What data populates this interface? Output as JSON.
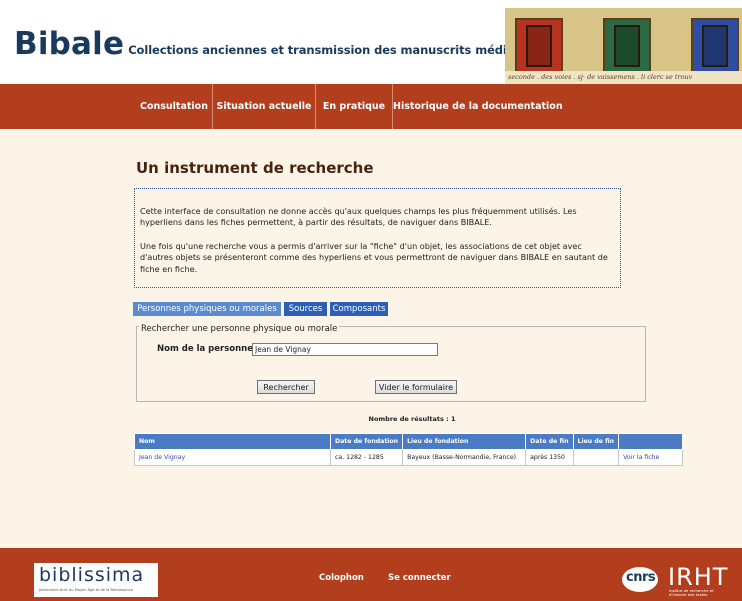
{
  "header": {
    "brand": "Bibale",
    "subtitle": "Collections anciennes et transmission des manuscrits médiévaux",
    "illumination_caption": "seconde . des voies . sj· de vaissemens . li clerc se trouv"
  },
  "nav": {
    "items": [
      {
        "label": "Consultation"
      },
      {
        "label": "Situation actuelle"
      },
      {
        "label": "En pratique"
      },
      {
        "label": "Historique de la documentation"
      }
    ]
  },
  "main": {
    "title": "Un instrument de recherche",
    "intro_p1": "Cette interface de consultation ne donne accès qu'aux quelques champs les plus fréquemment utilisés. Les hyperliens dans les fiches permettent, à partir des résultats, de naviguer dans BIBALE.",
    "intro_p2": "Une fois qu'une recherche vous a permis d'arriver sur la \"fiche\" d'un objet, les associations de cet objet avec d'autres objets se présenteront comme des hyperliens et vous permettront de naviguer dans BIBALE en sautant de fiche en fiche."
  },
  "tabs": [
    {
      "label": "Personnes physiques ou morales",
      "active": true
    },
    {
      "label": "Sources",
      "active": false
    },
    {
      "label": "Composants",
      "active": false
    }
  ],
  "search": {
    "legend": "Rechercher une personne physique ou morale",
    "name_label": "Nom de la personne :",
    "name_value": "Jean de Vignay",
    "search_button": "Rechercher",
    "clear_button": "Vider le formulaire"
  },
  "results": {
    "count_text": "Nombre de résultats : 1",
    "columns": [
      "Nom",
      "Date de fondation",
      "Lieu de fondation",
      "Date de fin",
      "Lieu de fin",
      ""
    ],
    "rows": [
      {
        "nom": "Jean de Vignay",
        "date_fondation": "ca. 1282 - 1285",
        "lieu_fondation": "Bayeux (Basse-Normandie, France)",
        "date_fin": "après 1350",
        "lieu_fin": "",
        "action": "Voir la fiche"
      }
    ]
  },
  "footer": {
    "logo_text": "biblissima",
    "logo_tagline": "patrimoine écrit du Moyen Âge et de la Renaissance",
    "colophon": "Colophon",
    "login": "Se connecter",
    "cnrs": "cnrs",
    "irht": "IRHT",
    "irht_tagline": "Institut de recherche et d'histoire des textes"
  },
  "colors": {
    "nav_red": "#b23e1e",
    "page_bg": "#fcf4e6",
    "brand_blue": "#183a5c",
    "tab_blue": "#2e5fb8",
    "table_header_blue": "#4a7cc6"
  }
}
